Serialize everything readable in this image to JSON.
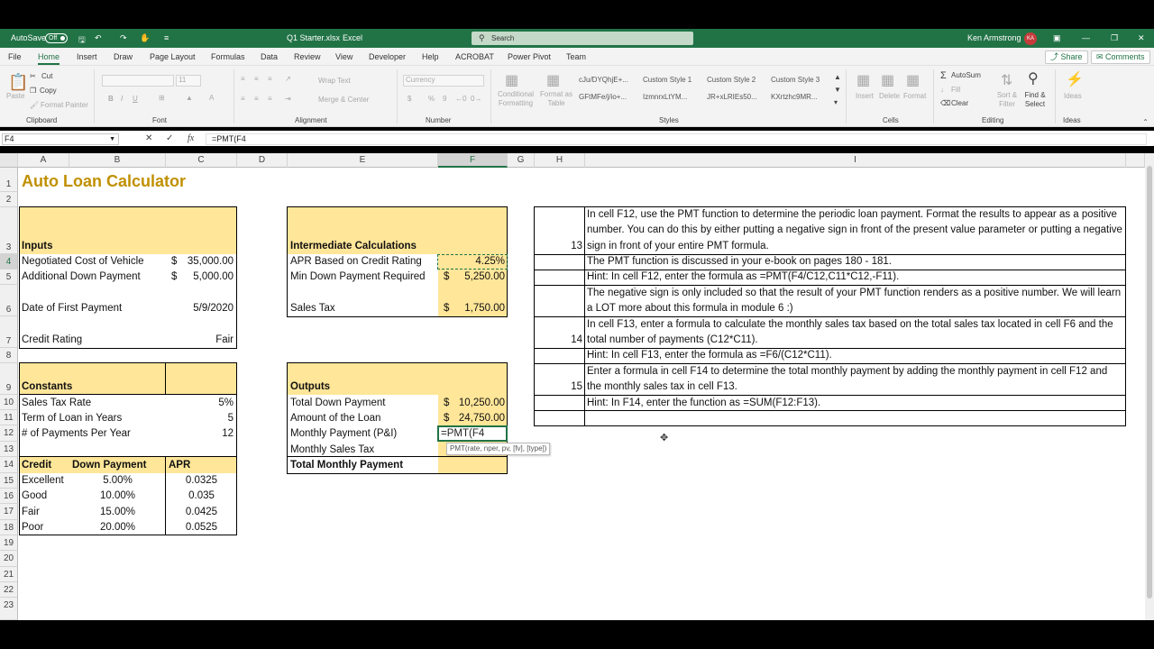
{
  "titlebar": {
    "autosave_label": "AutoSave",
    "autosave_state": "Off",
    "filename": "Q1 Starter.xlsx",
    "app": "Excel",
    "search_placeholder": "Search",
    "user_name": "Ken Armstrong",
    "user_initials": "KA",
    "accent_color": "#217346"
  },
  "menu": {
    "tabs": [
      "File",
      "Home",
      "Insert",
      "Draw",
      "Page Layout",
      "Formulas",
      "Data",
      "Review",
      "View",
      "Developer",
      "Help",
      "ACROBAT",
      "Power Pivot",
      "Team"
    ],
    "active": "Home",
    "share": "Share",
    "comments": "Comments"
  },
  "ribbon": {
    "clipboard": {
      "paste": "Paste",
      "cut": "Cut",
      "copy": "Copy",
      "format_painter": "Format Painter",
      "label": "Clipboard"
    },
    "font": {
      "label": "Font",
      "bold": "B",
      "italic": "I",
      "underline": "U",
      "size": "11"
    },
    "alignment": {
      "label": "Alignment",
      "wrap": "Wrap Text",
      "merge": "Merge & Center"
    },
    "number": {
      "label": "Number",
      "format": "Currency",
      "dollar": "$",
      "percent": "%",
      "comma": "9"
    },
    "styles": {
      "label": "Styles",
      "conditional": "Conditional Formatting",
      "format_as_table": "Format as Table",
      "cells": [
        "cJu/DYQhjE+...",
        "Custom Style 1",
        "Custom Style 2",
        "Custom Style 3",
        "GFtMFe/j/io+...",
        "IzmnrxLtYM...",
        "JR+xLRIEs50...",
        "KXrtzhc9MR..."
      ]
    },
    "cells": {
      "label": "Cells",
      "insert": "Insert",
      "delete": "Delete",
      "format": "Format"
    },
    "editing": {
      "label": "Editing",
      "autosum": "AutoSum",
      "fill": "Fill",
      "clear": "Clear",
      "sort": "Sort & Filter",
      "find": "Find & Select"
    },
    "ideas": {
      "label": "Ideas",
      "ideas": "Ideas"
    }
  },
  "formula_bar": {
    "name_box": "F4",
    "formula": "=PMT(F4"
  },
  "columns": [
    "A",
    "B",
    "C",
    "D",
    "E",
    "F",
    "G",
    "H",
    "I"
  ],
  "rows": [
    "1",
    "2",
    "3",
    "4",
    "5",
    "6",
    "7",
    "8",
    "9",
    "10",
    "11",
    "12",
    "13",
    "14",
    "15",
    "16",
    "17",
    "18",
    "19",
    "20",
    "21",
    "22",
    "23"
  ],
  "sheet": {
    "title": "Auto Loan Calculator",
    "title_color": "#c09000",
    "fill_color": "#ffe699",
    "inputs": {
      "header": "Inputs",
      "cost_label": "Negotiated Cost of Vehicle",
      "cost_sym": "$",
      "cost_val": "35,000.00",
      "down_label": "Additional Down  Payment",
      "down_sym": "$",
      "down_val": "5,000.00",
      "date_label": "Date of First Payment",
      "date_val": "5/9/2020",
      "rating_label": "Credit Rating",
      "rating_val": "Fair"
    },
    "constants": {
      "header": "Constants",
      "tax_label": "Sales Tax Rate",
      "tax_val": "5%",
      "term_label": "Term of Loan in Years",
      "term_val": "5",
      "payments_label": "# of Payments Per Year",
      "payments_val": "12"
    },
    "credit_table": {
      "headers": [
        "Credit",
        "Down Payment",
        "APR"
      ],
      "rows": [
        [
          "Excellent",
          "5.00%",
          "0.0325"
        ],
        [
          "Good",
          "10.00%",
          "0.035"
        ],
        [
          "Fair",
          "15.00%",
          "0.0425"
        ],
        [
          "Poor",
          "20.00%",
          "0.0525"
        ]
      ]
    },
    "intermediate": {
      "header": "Intermediate Calculations",
      "apr_label": "APR Based on Credit Rating",
      "apr_val": "4.25%",
      "min_down_label": "Min Down Payment Required",
      "min_down_sym": "$",
      "min_down_val": "5,250.00",
      "sales_tax_label": "Sales Tax",
      "sales_tax_sym": "$",
      "sales_tax_val": "1,750.00"
    },
    "outputs": {
      "header": "Outputs",
      "total_down_label": "Total Down Payment",
      "total_down_sym": "$",
      "total_down_val": "10,250.00",
      "loan_label": "Amount of the Loan",
      "loan_sym": "$",
      "loan_val": "24,750.00",
      "monthly_label": "Monthly Payment (P&I)",
      "monthly_editing": "=PMT(F4",
      "monthly_tax_label": "Monthly Sales Tax",
      "total_monthly_label": "Total Monthly Payment",
      "tooltip": "PMT(rate, nper, pv, [fv], [type])"
    },
    "instructions": {
      "n13": "13",
      "t13": "In cell F12, use the PMT function to determine the periodic loan payment. Format the results to appear as a positive number. You can do this by either putting a negative sign in front of the present value parameter or putting a negative sign in front of your entire PMT formula.",
      "t13b": "The PMT function is discussed in your e-book on pages 180 - 181.",
      "t13c": "Hint: In cell F12, enter the formula as =PMT(F4/C12,C11*C12,-F11).",
      "t13d": "The negative sign is only included so that the result of your PMT function renders as a positive number. We will learn a LOT more about this formula in module 6 :)",
      "n14": "14",
      "t14": "In cell F13, enter a formula to calculate the monthly sales tax based on the total sales tax located in cell F6 and the total number of payments (C12*C11).",
      "t14b": "Hint: In cell F13, enter the formula as =F6/(C12*C11).",
      "n15": "15",
      "t15": "Enter a formula in cell F14 to determine the total monthly payment by adding the monthly payment in cell F12 and the monthly sales tax in cell F13.",
      "t15b": "Hint: In F14, enter the function as =SUM(F12:F13)."
    }
  }
}
